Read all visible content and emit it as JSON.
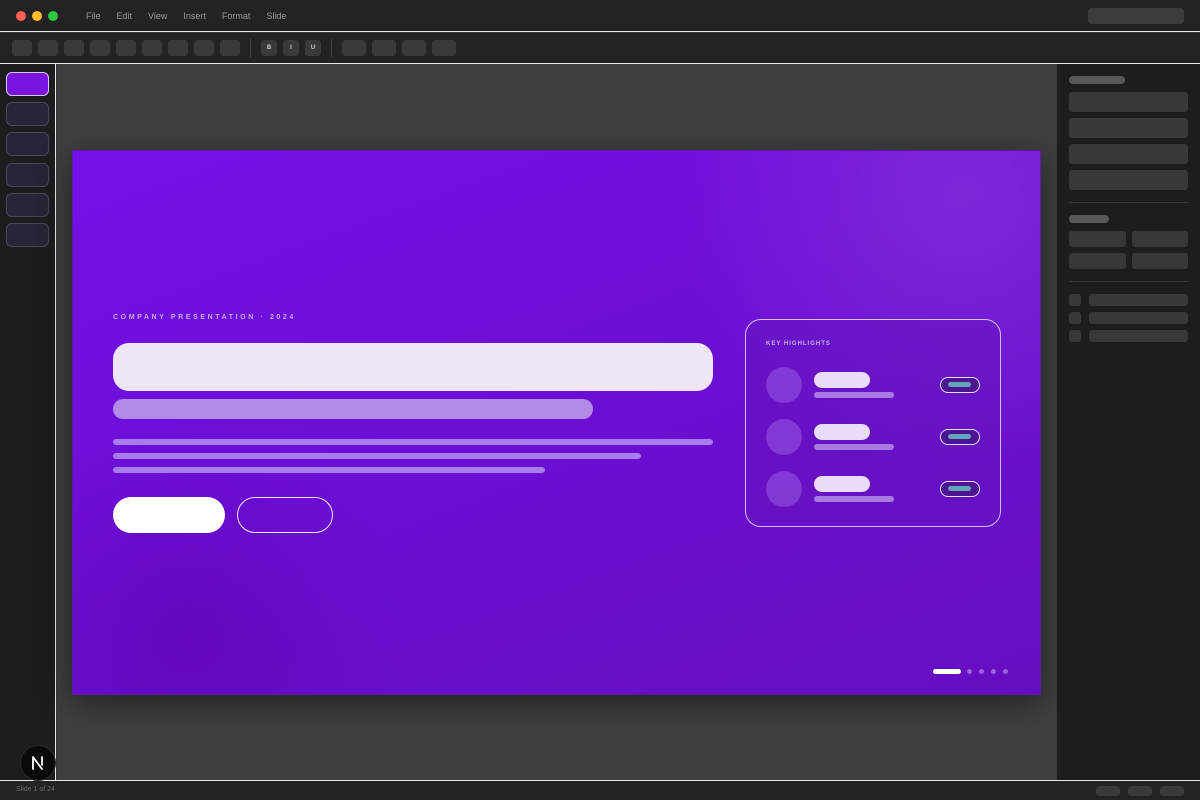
{
  "window": {
    "controls": [
      {
        "name": "close",
        "color": "#ff5f57"
      },
      {
        "name": "minimize",
        "color": "#febc2e"
      },
      {
        "name": "maximize",
        "color": "#28c840"
      }
    ],
    "menu": [
      "File",
      "Edit",
      "View",
      "Insert",
      "Format",
      "Slide"
    ]
  },
  "toolbar": {
    "bold_label": "B",
    "italic_label": "I",
    "underline_label": "U"
  },
  "slide_panel": {
    "slide_count": 6,
    "active_index": 0
  },
  "slide": {
    "eyebrow": "COMPANY PRESENTATION · 2024",
    "highlights_title": "KEY HIGHLIGHTS",
    "highlight_count": 3,
    "page_dots": 5,
    "active_dot": 0
  },
  "colors": {
    "slide_purple": "#6f10dc",
    "accent_teal": "#60a6b8",
    "chrome_dark": "#232323"
  },
  "status": {
    "slide_position": "Slide 1 of 24"
  },
  "logo": {
    "letter": "N"
  }
}
